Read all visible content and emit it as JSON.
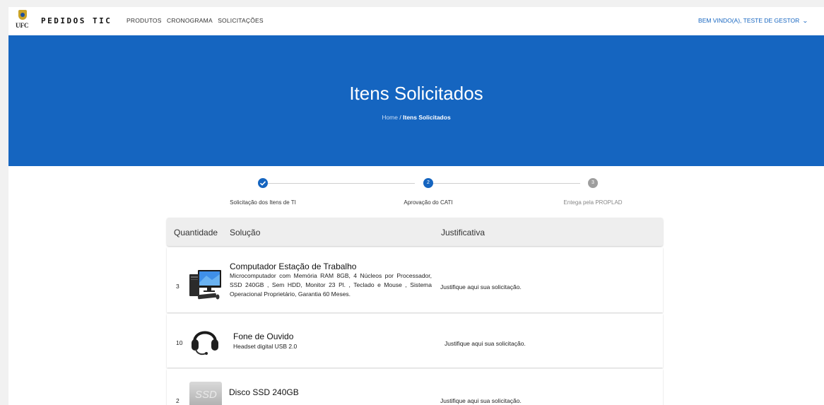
{
  "header": {
    "logo_text": "UFC",
    "brand": "PEDIDOS TIC",
    "nav": [
      "PRODUTOS",
      "CRONOGRAMA",
      "SOLICITAÇÕES"
    ],
    "user": "BEM VINDO(A), TESTE DE GESTOR",
    "user_icon": "chevron-down-icon"
  },
  "hero": {
    "title": "Itens Solicitados",
    "breadcrumb": {
      "home": "Home",
      "separator": "/",
      "current": "Itens Solicitados"
    }
  },
  "stepper": [
    {
      "label": "Solicitação dos Itens de TI",
      "state": "done",
      "icon": "check-icon"
    },
    {
      "label": "Aprovação do CATI",
      "state": "active",
      "number": "2"
    },
    {
      "label": "Entega pela PROPLAD",
      "state": "pending",
      "number": "3"
    }
  ],
  "table": {
    "headers": {
      "quantity": "Quantidade",
      "solution": "Solução",
      "justification": "Justificativa"
    },
    "rows": [
      {
        "quantity": "3",
        "image": "desktop-computer-image",
        "title": "Computador Estação de Trabalho",
        "description": "Microcomputador com Memória RAM 8GB, 4 Núcleos por Processador, SSD 240GB , Sem HDD, Monitor 23 Pl. , Teclado e Mouse , Sistema Operacional Proprietário, Garantia 60 Meses.",
        "justification": "Justifique aqui sua solicitação."
      },
      {
        "quantity": "10",
        "image": "headset-image",
        "title": "Fone de Ouvido",
        "description": "Headset digital USB 2.0",
        "justification": "Justifique aqui sua solicitação."
      },
      {
        "quantity": "2",
        "image": "ssd-image",
        "image_text": "SSD",
        "title": "Disco SSD 240GB",
        "description": "",
        "justification": "Justifique aqui sua solicitação."
      }
    ]
  },
  "colors": {
    "primary": "#1565c0",
    "step_pending": "#9e9e9e",
    "table_header": "#eeeeee",
    "page_bg": "#f1f1f1"
  }
}
